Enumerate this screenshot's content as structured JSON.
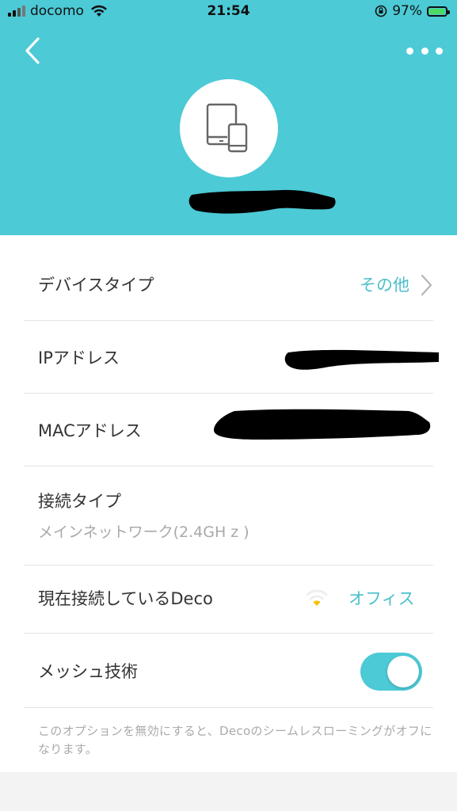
{
  "status_bar": {
    "carrier": "docomo",
    "time": "21:54",
    "battery": "97%",
    "battery_level": 0.97
  },
  "header": {
    "device_icon": "tablet-phone-icon",
    "device_name_redacted": true
  },
  "rows": {
    "device_type": {
      "label": "デバイスタイプ",
      "value": "その他"
    },
    "ip_address": {
      "label": "IPアドレス"
    },
    "mac_address": {
      "label": "MACアドレス"
    },
    "connection_type": {
      "label": "接続タイプ",
      "value": "メインネットワーク(2.4GH z )"
    },
    "current_deco": {
      "label": "現在接続しているDeco",
      "value": "オフィス",
      "signal_color": "#f2c200"
    },
    "mesh": {
      "label": "メッシュ技術",
      "enabled": true
    }
  },
  "footnote": "このオプションを無効にすると、Decoのシームレスローミングがオフになります。",
  "colors": {
    "accent": "#4ccad6",
    "link": "#4bbfcb",
    "text": "#333333",
    "subtext": "#a9a9a9"
  }
}
